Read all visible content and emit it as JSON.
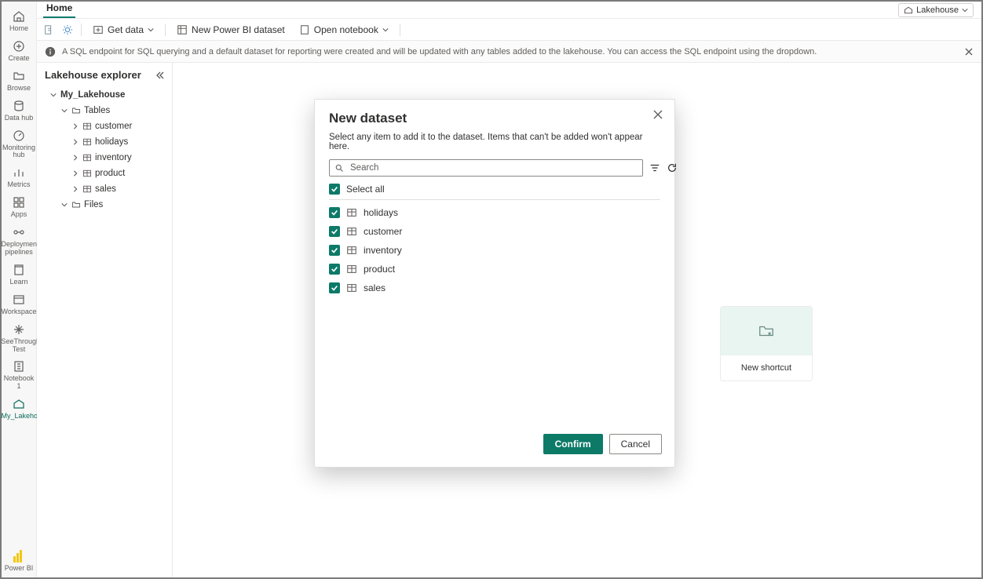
{
  "rail": {
    "items": [
      {
        "label": "Home"
      },
      {
        "label": "Create"
      },
      {
        "label": "Browse"
      },
      {
        "label": "Data hub"
      },
      {
        "label": "Monitoring hub"
      },
      {
        "label": "Metrics"
      },
      {
        "label": "Apps"
      },
      {
        "label": "Deployment pipelines"
      },
      {
        "label": "Learn"
      },
      {
        "label": "Workspaces"
      },
      {
        "label": "SeeThrough Test"
      },
      {
        "label": "Notebook 1"
      },
      {
        "label": "My_Lakehouse"
      }
    ],
    "bottom_label": "Power BI"
  },
  "header": {
    "tab_label": "Home",
    "mode_label": "Lakehouse"
  },
  "toolbar": {
    "get_data": "Get data",
    "new_dataset": "New Power BI dataset",
    "open_notebook": "Open notebook"
  },
  "infobar": {
    "text": "A SQL endpoint for SQL querying and a default dataset for reporting were created and will be updated with any tables added to the lakehouse. You can access the SQL endpoint using the dropdown."
  },
  "explorer": {
    "title": "Lakehouse explorer",
    "root": "My_Lakehouse",
    "tables_label": "Tables",
    "tables": [
      "customer",
      "holidays",
      "inventory",
      "product",
      "sales"
    ],
    "files_label": "Files"
  },
  "shortcut_card": {
    "label": "New shortcut"
  },
  "modal": {
    "title": "New dataset",
    "subtitle": "Select any item to add it to the dataset. Items that can't be added won't appear here.",
    "search_placeholder": "Search",
    "select_all": "Select all",
    "items": [
      "holidays",
      "customer",
      "inventory",
      "product",
      "sales"
    ],
    "confirm": "Confirm",
    "cancel": "Cancel"
  }
}
